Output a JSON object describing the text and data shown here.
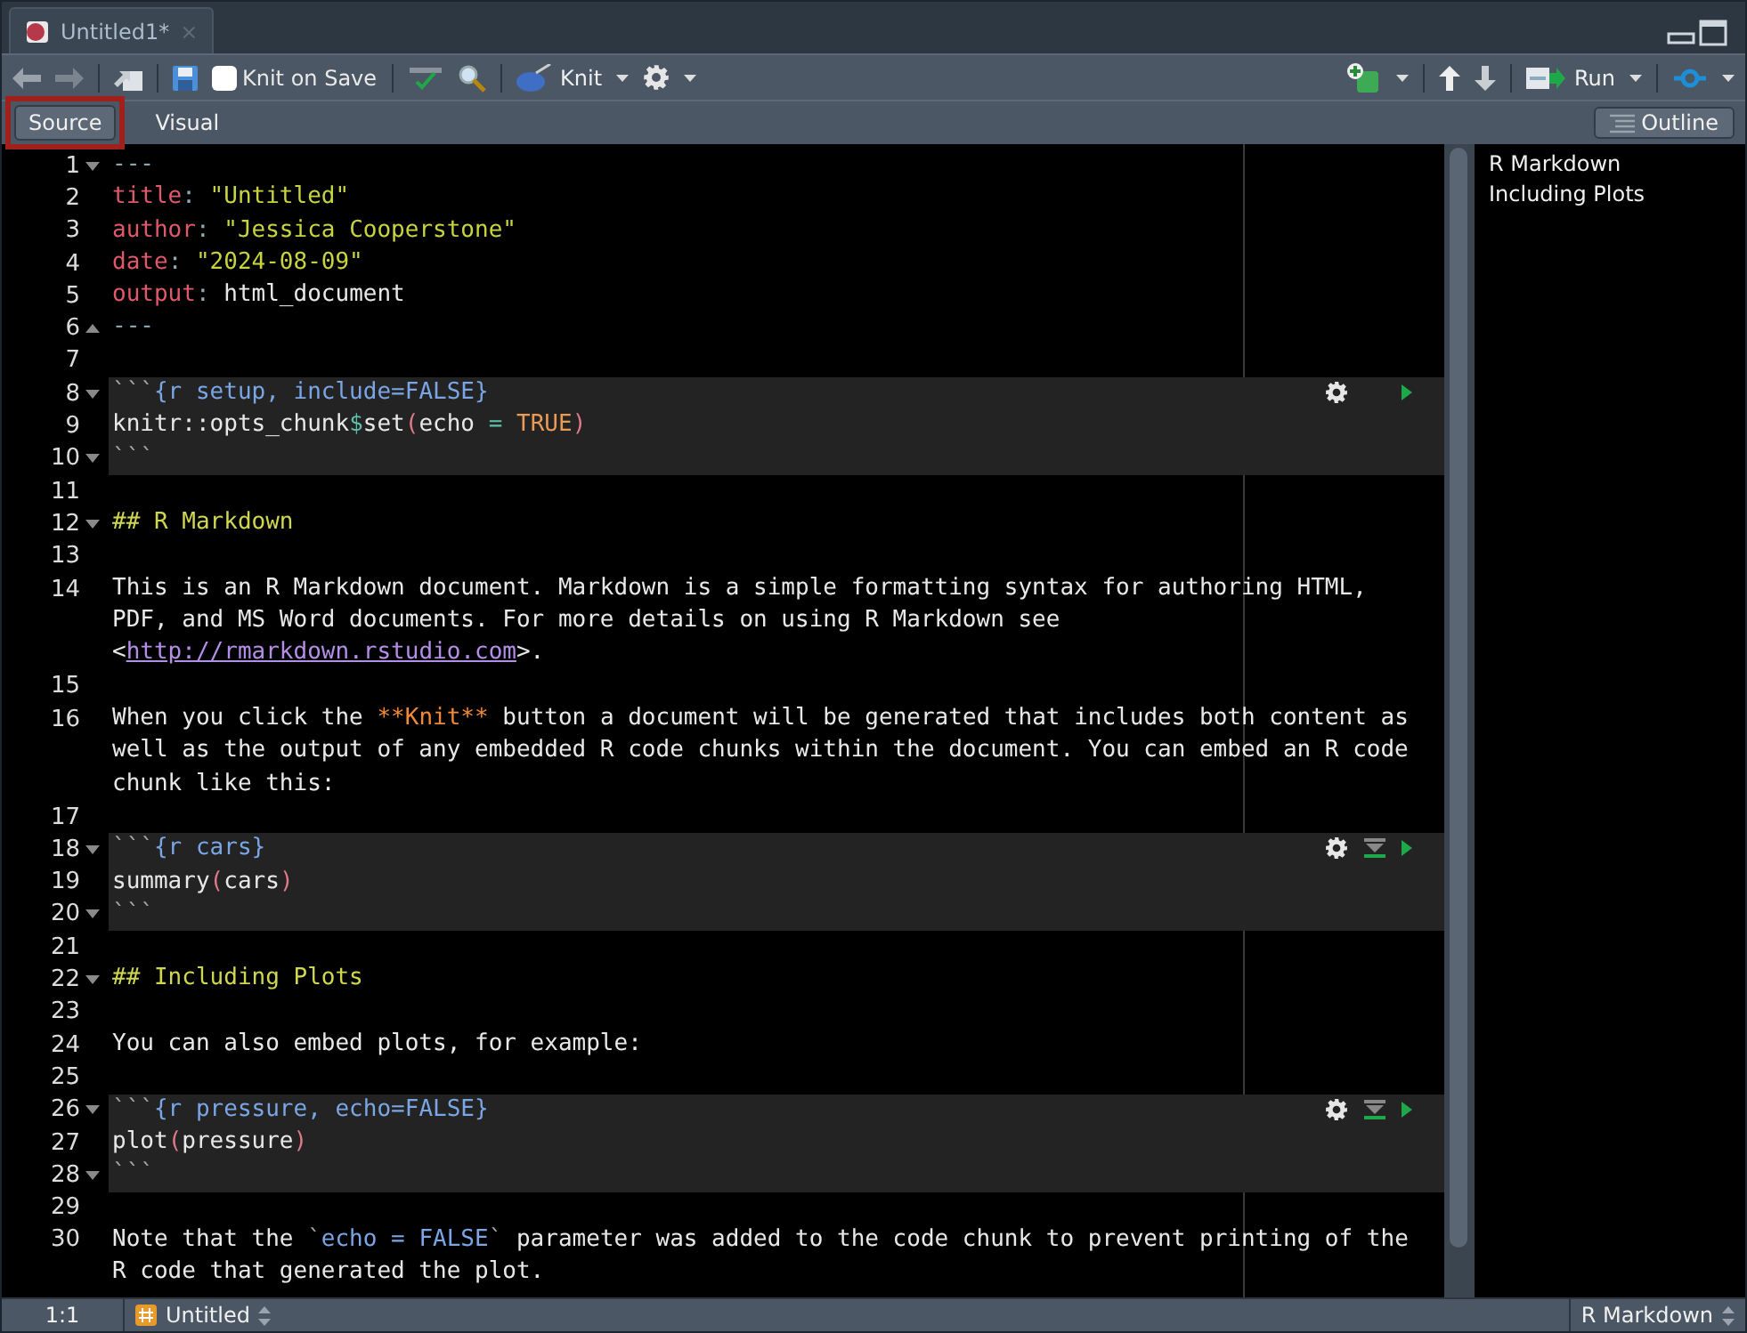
{
  "tab": {
    "title": "Untitled1*",
    "close": "×"
  },
  "toolbar": {
    "knit_on_save": {
      "label": "Knit on Save",
      "checked": false
    },
    "knit": {
      "label": "Knit"
    },
    "run": {
      "label": "Run"
    }
  },
  "mode_tabs": [
    {
      "label": "Source",
      "selected": true,
      "highlighted": true
    },
    {
      "label": "Visual",
      "selected": false,
      "highlighted": false
    }
  ],
  "outline_button": {
    "label": "Outline"
  },
  "editor": {
    "lines": [
      {
        "n": "1",
        "foldable": true,
        "fold_end": false,
        "kind": "text",
        "rows": [
          [
            {
              "kind": "punct",
              "text": "---"
            }
          ]
        ]
      },
      {
        "n": "2",
        "foldable": false,
        "kind": "text",
        "rows": [
          [
            {
              "kind": "key",
              "text": "title"
            },
            {
              "kind": "punct",
              "text": ": "
            },
            {
              "kind": "string",
              "text": "\"Untitled\""
            }
          ]
        ]
      },
      {
        "n": "3",
        "foldable": false,
        "kind": "text",
        "rows": [
          [
            {
              "kind": "key",
              "text": "author"
            },
            {
              "kind": "punct",
              "text": ": "
            },
            {
              "kind": "string",
              "text": "\"Jessica Cooperstone\""
            }
          ]
        ]
      },
      {
        "n": "4",
        "foldable": false,
        "kind": "text",
        "rows": [
          [
            {
              "kind": "key",
              "text": "date"
            },
            {
              "kind": "punct",
              "text": ": "
            },
            {
              "kind": "string",
              "text": "\"2024-08-09\""
            }
          ]
        ]
      },
      {
        "n": "5",
        "foldable": false,
        "kind": "text",
        "rows": [
          [
            {
              "kind": "key",
              "text": "output"
            },
            {
              "kind": "punct",
              "text": ": "
            },
            {
              "kind": "plain",
              "text": "html_document"
            }
          ]
        ]
      },
      {
        "n": "6",
        "foldable": true,
        "fold_end": true,
        "kind": "text",
        "rows": [
          [
            {
              "kind": "punct",
              "text": "---"
            }
          ]
        ]
      },
      {
        "n": "7",
        "foldable": false,
        "kind": "text"
      },
      {
        "n": "8",
        "foldable": true,
        "fold_end": false,
        "kind": "chunk_header",
        "run_above": false,
        "rows": [
          [
            {
              "kind": "tick",
              "text": "```"
            },
            {
              "kind": "chunk",
              "text": "{r setup, include=FALSE}"
            }
          ]
        ]
      },
      {
        "n": "9",
        "foldable": false,
        "kind": "chunk",
        "rows": [
          [
            {
              "kind": "plain",
              "text": "knitr::opts_chunk"
            },
            {
              "kind": "op",
              "text": "$"
            },
            {
              "kind": "plain",
              "text": "set"
            },
            {
              "kind": "paren",
              "text": "("
            },
            {
              "kind": "plain",
              "text": "echo "
            },
            {
              "kind": "op",
              "text": "= "
            },
            {
              "kind": "keyword",
              "text": "TRUE"
            },
            {
              "kind": "paren",
              "text": ")"
            }
          ]
        ]
      },
      {
        "n": "10",
        "foldable": true,
        "fold_end": false,
        "kind": "chunk",
        "rows": [
          [
            {
              "kind": "tick",
              "text": "```"
            }
          ]
        ]
      },
      {
        "n": "11",
        "foldable": false,
        "kind": "text"
      },
      {
        "n": "12",
        "foldable": true,
        "fold_end": false,
        "kind": "text",
        "rows": [
          [
            {
              "kind": "heading",
              "text": "## R Markdown"
            }
          ]
        ]
      },
      {
        "n": "13",
        "foldable": false,
        "kind": "text"
      },
      {
        "n": "14",
        "foldable": false,
        "kind": "text",
        "rows": [
          [
            {
              "kind": "plain",
              "text": "This is an R Markdown document. Markdown is a simple formatting syntax for authoring HTML,"
            }
          ],
          [
            {
              "kind": "plain",
              "text": "PDF, and MS Word documents. For more details on using R Markdown see"
            }
          ],
          [
            {
              "kind": "plain",
              "text": "<"
            },
            {
              "kind": "link",
              "text": "http://rmarkdown.rstudio.com"
            },
            {
              "kind": "plain",
              "text": ">."
            }
          ]
        ]
      },
      {
        "n": "15",
        "foldable": false,
        "kind": "text"
      },
      {
        "n": "16",
        "foldable": false,
        "kind": "text",
        "rows": [
          [
            {
              "kind": "plain",
              "text": "When you click the "
            },
            {
              "kind": "bold",
              "text": "**Knit**"
            },
            {
              "kind": "plain",
              "text": " button a document will be generated that includes both content as"
            }
          ],
          [
            {
              "kind": "plain",
              "text": "well as the output of any embedded R code chunks within the document. You can embed an R code"
            }
          ],
          [
            {
              "kind": "plain",
              "text": "chunk like this:"
            }
          ]
        ]
      },
      {
        "n": "17",
        "foldable": false,
        "kind": "text"
      },
      {
        "n": "18",
        "foldable": true,
        "fold_end": false,
        "kind": "chunk_header",
        "run_above": true,
        "rows": [
          [
            {
              "kind": "tick",
              "text": "```"
            },
            {
              "kind": "chunk",
              "text": "{r cars}"
            }
          ]
        ]
      },
      {
        "n": "19",
        "foldable": false,
        "kind": "chunk",
        "rows": [
          [
            {
              "kind": "plain",
              "text": "summary"
            },
            {
              "kind": "paren",
              "text": "("
            },
            {
              "kind": "plain",
              "text": "cars"
            },
            {
              "kind": "paren",
              "text": ")"
            }
          ]
        ]
      },
      {
        "n": "20",
        "foldable": true,
        "fold_end": false,
        "kind": "chunk",
        "rows": [
          [
            {
              "kind": "tick",
              "text": "```"
            }
          ]
        ]
      },
      {
        "n": "21",
        "foldable": false,
        "kind": "text"
      },
      {
        "n": "22",
        "foldable": true,
        "fold_end": false,
        "kind": "text",
        "rows": [
          [
            {
              "kind": "heading",
              "text": "## Including Plots"
            }
          ]
        ]
      },
      {
        "n": "23",
        "foldable": false,
        "kind": "text"
      },
      {
        "n": "24",
        "foldable": false,
        "kind": "text",
        "rows": [
          [
            {
              "kind": "plain",
              "text": "You can also embed plots, for example:"
            }
          ]
        ]
      },
      {
        "n": "25",
        "foldable": false,
        "kind": "text"
      },
      {
        "n": "26",
        "foldable": true,
        "fold_end": false,
        "kind": "chunk_header",
        "run_above": true,
        "rows": [
          [
            {
              "kind": "tick",
              "text": "```"
            },
            {
              "kind": "chunk",
              "text": "{r pressure, echo=FALSE}"
            }
          ]
        ]
      },
      {
        "n": "27",
        "foldable": false,
        "kind": "chunk",
        "rows": [
          [
            {
              "kind": "plain",
              "text": "plot"
            },
            {
              "kind": "paren",
              "text": "("
            },
            {
              "kind": "plain",
              "text": "pressure"
            },
            {
              "kind": "paren",
              "text": ")"
            }
          ]
        ]
      },
      {
        "n": "28",
        "foldable": true,
        "fold_end": false,
        "kind": "chunk",
        "rows": [
          [
            {
              "kind": "tick",
              "text": "```"
            }
          ]
        ]
      },
      {
        "n": "29",
        "foldable": false,
        "kind": "text"
      },
      {
        "n": "30",
        "foldable": false,
        "kind": "text",
        "rows": [
          [
            {
              "kind": "plain",
              "text": "Note that the "
            },
            {
              "kind": "tick",
              "text": "`"
            },
            {
              "kind": "chunk",
              "text": "echo = FALSE"
            },
            {
              "kind": "tick",
              "text": "`"
            },
            {
              "kind": "plain",
              "text": " parameter was added to the code chunk to prevent printing of the"
            }
          ],
          [
            {
              "kind": "plain",
              "text": "R code that generated the plot."
            }
          ]
        ]
      }
    ]
  },
  "outline": {
    "items": [
      "R Markdown",
      "Including Plots"
    ]
  },
  "status_bar": {
    "position": "1:1",
    "document": "Untitled",
    "file_type": "R Markdown"
  }
}
